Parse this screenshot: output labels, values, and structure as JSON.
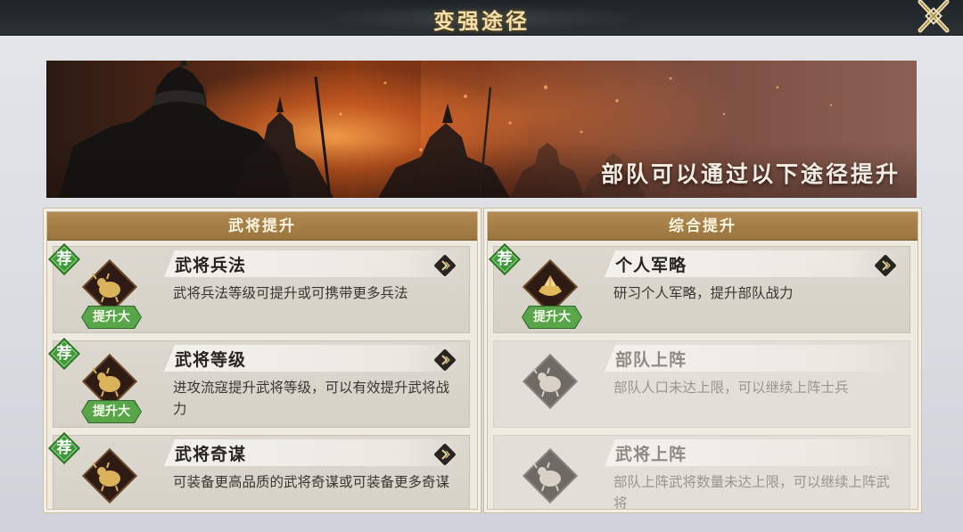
{
  "header": {
    "title": "变强途径"
  },
  "banner": {
    "text": "部队可以通过以下途径提升"
  },
  "panels": {
    "left": {
      "title": "武将提升",
      "cards": [
        {
          "title": "武将兵法",
          "desc": "武将兵法等级可提升或可携带更多兵法",
          "rec": "荐",
          "tag": "提升大",
          "icon": "bull-icon"
        },
        {
          "title": "武将等级",
          "desc": "进攻流寇提升武将等级，可以有效提升武将战力",
          "rec": "荐",
          "tag": "提升大",
          "icon": "bull-icon"
        },
        {
          "title": "武将奇谋",
          "desc": "可装备更高品质的武将奇谋或可装备更多奇谋",
          "rec": "荐",
          "icon": "bull-icon"
        }
      ]
    },
    "right": {
      "title": "综合提升",
      "cards": [
        {
          "title": "个人军略",
          "desc": "研习个人军略，提升部队战力",
          "rec": "荐",
          "tag": "提升大",
          "icon": "gold-ingot-icon"
        },
        {
          "title": "部队上阵",
          "desc": "部队人口未达上限，可以继续上阵士兵",
          "icon": "bull-icon"
        },
        {
          "title": "武将上阵",
          "desc": "部队上阵武将数量未达上限，可以继续上阵武将",
          "icon": "bull-icon"
        }
      ]
    }
  },
  "colors": {
    "gold": "#f2dfae",
    "panel_header": "#a27b44",
    "recommend_green": "#3f9a3a",
    "boost_green": "#59a54a",
    "icon_dark": "#2e1c14",
    "icon_gold": "#d9b25a"
  }
}
